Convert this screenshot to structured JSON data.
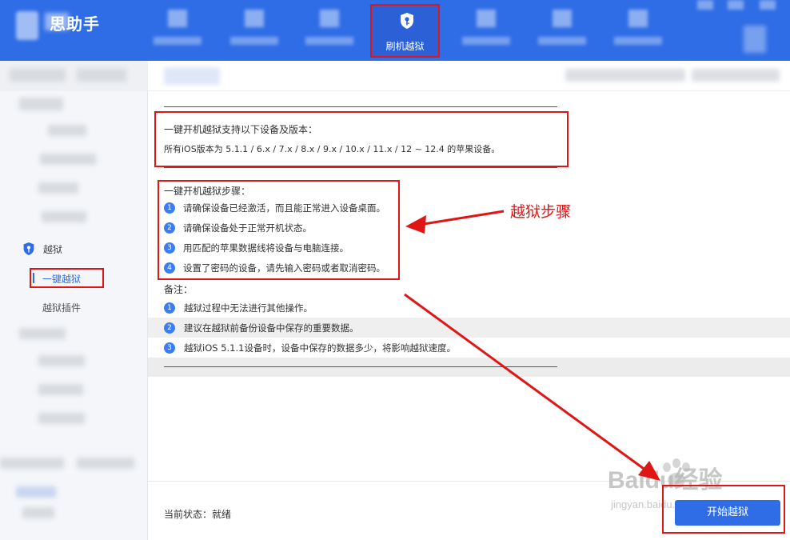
{
  "app": {
    "logo_text": "思助手"
  },
  "topnav": {
    "active_label": "刷机越狱"
  },
  "sidebar": {
    "group_label": "越狱",
    "active_item": "一键越狱",
    "item_plugin": "越狱插件"
  },
  "support": {
    "title": "一键开机越狱支持以下设备及版本：",
    "versions": "所有iOS版本为 5.1.1 / 6.x / 7.x / 8.x / 9.x / 10.x / 11.x / 12 ~ 12.4 的苹果设备。"
  },
  "steps": {
    "title": "一键开机越狱步骤：",
    "items": [
      {
        "num": "1",
        "text": "请确保设备已经激活，而且能正常进入设备桌面。"
      },
      {
        "num": "2",
        "text": "请确保设备处于正常开机状态。"
      },
      {
        "num": "3",
        "text": "用匹配的苹果数据线将设备与电脑连接。"
      },
      {
        "num": "4",
        "text": "设置了密码的设备，请先输入密码或者取消密码。"
      }
    ]
  },
  "notes": {
    "title": "备注：",
    "items": [
      {
        "num": "1",
        "text": "越狱过程中无法进行其他操作。"
      },
      {
        "num": "2",
        "text": "建议在越狱前备份设备中保存的重要数据。"
      },
      {
        "num": "3",
        "text": "越狱iOS 5.1.1设备时，设备中保存的数据多少，将影响越狱速度。"
      }
    ]
  },
  "annotation": {
    "text": "越狱步骤",
    "color": "#e01515"
  },
  "footer": {
    "status_text": "当前状态：就绪",
    "start_label": "开始越狱"
  },
  "watermark": {
    "brand": "Baidu经验",
    "url": "jingyan.baidu.com"
  },
  "colors": {
    "brand_blue": "#2f6de6",
    "highlight_red": "#e01515"
  }
}
